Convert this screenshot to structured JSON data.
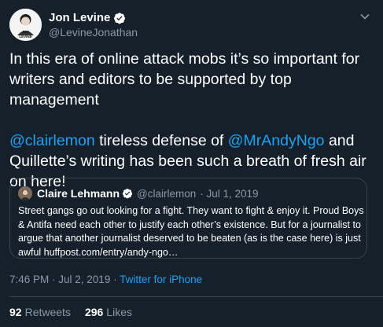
{
  "author": {
    "display_name": "Jon Levine",
    "handle": "@LevineJonathan",
    "verified": true,
    "avatar_text": "JON LEVINE"
  },
  "tweet": {
    "paragraph1": "In this era of online attack mobs it’s so important for writers and editors to be supported by top management",
    "paragraph2": {
      "mention1": "@clairlemon",
      "text1": " tireless defense of ",
      "mention2": "@MrAndyNgo",
      "text2": " and Quillette’s writing has been such a breath of fresh air on here!"
    }
  },
  "quote": {
    "display_name": "Claire Lehmann",
    "handle": "@clairlemon",
    "date": "· Jul 1, 2019",
    "text": "Street gangs go out looking for a fight. They want to fight & enjoy it. Proud Boys & Antifa need each other to justify each other’s existence. But for a journalist to argue that another journalist deserved to be beaten (as is the case here) is just awful huffpost.com/entry/andy-ngo…"
  },
  "meta": {
    "timestamp": "7:46 PM · Jul 2, 2019 · ",
    "source": "Twitter for iPhone"
  },
  "stats": {
    "retweets_count": "92",
    "retweets_label": "Retweets",
    "likes_count": "296",
    "likes_label": "Likes"
  },
  "colors": {
    "background": "#15202b",
    "accent": "#1da1f2",
    "secondary_text": "#8899a6",
    "border": "#38444d"
  }
}
